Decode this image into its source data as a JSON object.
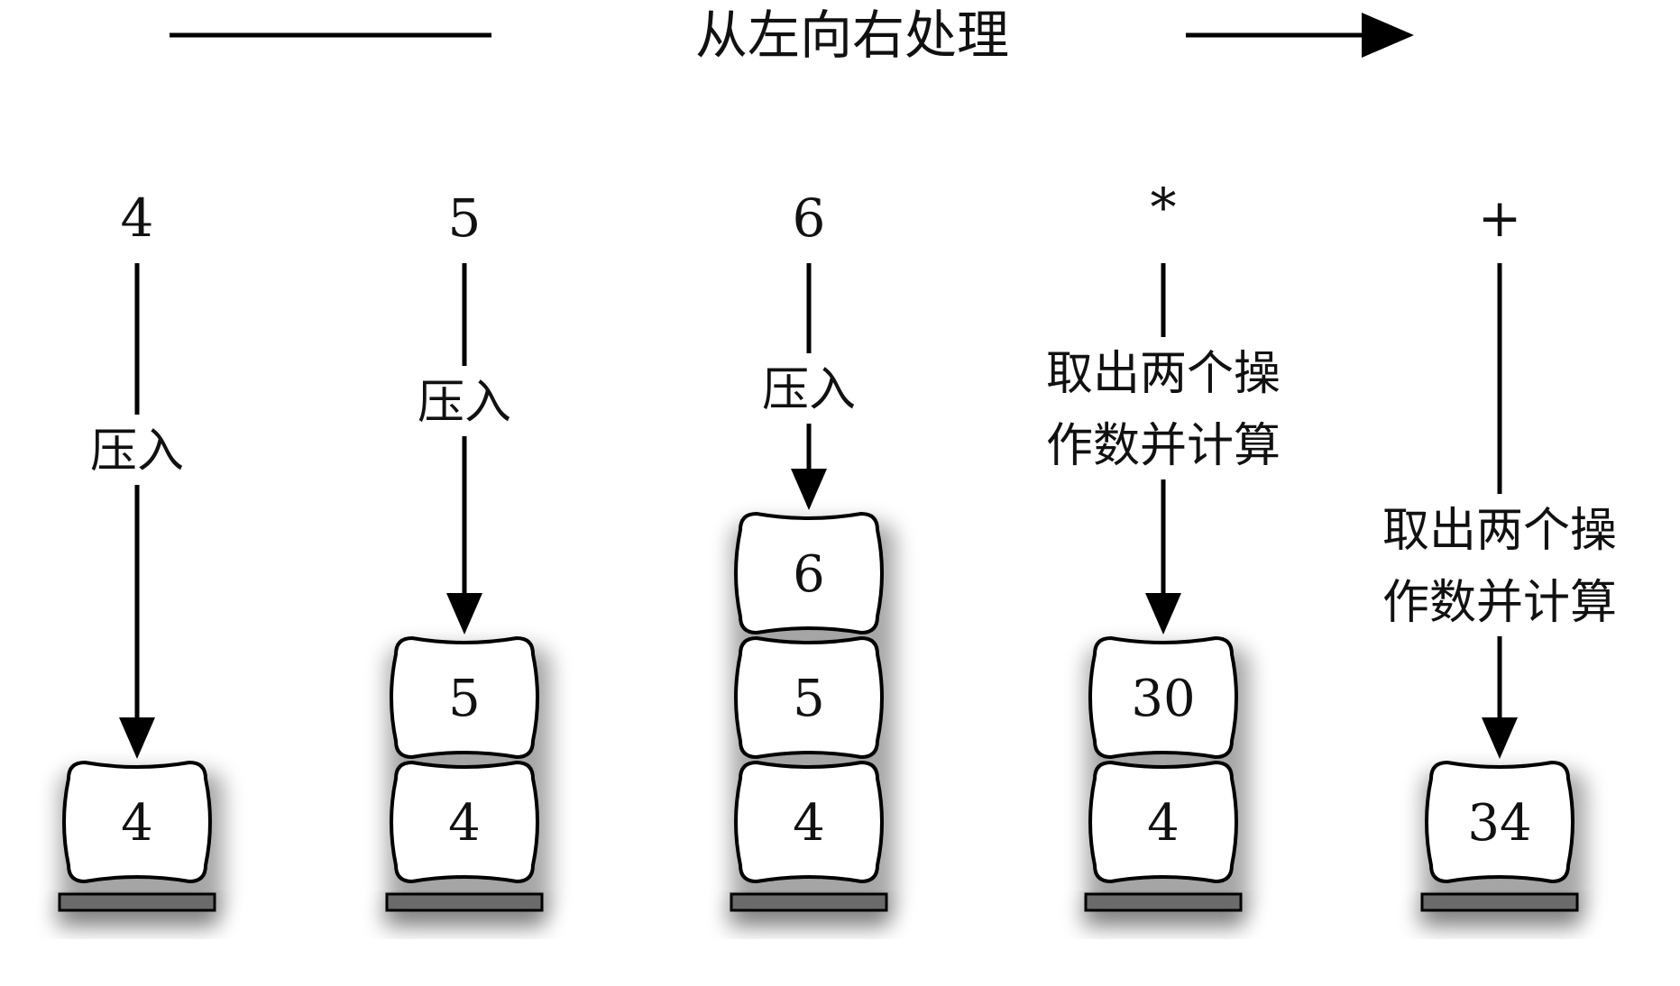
{
  "header": {
    "direction_label": "从左向右处理"
  },
  "steps": [
    {
      "token": "4",
      "action_lines": [
        "压入"
      ],
      "stack": [
        "4"
      ]
    },
    {
      "token": "5",
      "action_lines": [
        "压入"
      ],
      "stack": [
        "4",
        "5"
      ]
    },
    {
      "token": "6",
      "action_lines": [
        "压入"
      ],
      "stack": [
        "4",
        "5",
        "6"
      ]
    },
    {
      "token": "*",
      "action_lines": [
        "取出两个操",
        "作数并计算"
      ],
      "stack": [
        "4",
        "30"
      ]
    },
    {
      "token": "+",
      "action_lines": [
        "取出两个操",
        "作数并计算"
      ],
      "stack": [
        "34"
      ]
    }
  ]
}
